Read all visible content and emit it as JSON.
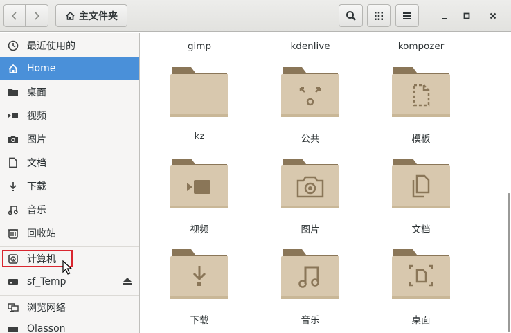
{
  "header": {
    "path_label": "主文件夹",
    "back_icon": "chevron-left-icon",
    "forward_icon": "chevron-right-icon",
    "home_icon": "home-icon",
    "search_icon": "search-icon",
    "view_icon": "grid-view-icon",
    "menu_icon": "hamburger-menu-icon"
  },
  "sidebar": {
    "items": [
      {
        "label": "最近使用的",
        "icon": "clock-icon"
      },
      {
        "label": "Home",
        "icon": "home-icon",
        "active": true
      },
      {
        "label": "桌面",
        "icon": "desktop-folder-icon"
      },
      {
        "label": "视频",
        "icon": "video-icon"
      },
      {
        "label": "图片",
        "icon": "camera-icon"
      },
      {
        "label": "文档",
        "icon": "document-icon"
      },
      {
        "label": "下载",
        "icon": "download-icon"
      },
      {
        "label": "音乐",
        "icon": "music-icon"
      },
      {
        "label": "回收站",
        "icon": "trash-icon"
      },
      {
        "label": "计算机",
        "icon": "computer-icon"
      },
      {
        "label": "sf_Temp",
        "icon": "drive-icon"
      },
      {
        "label": "浏览网络",
        "icon": "network-icon"
      },
      {
        "label": "Olasson",
        "icon": "drive-icon"
      }
    ]
  },
  "main": {
    "top_row_labels": [
      "gimp",
      "kdenlive",
      "kompozer"
    ],
    "folders": [
      {
        "label": "kz",
        "emblem": "none"
      },
      {
        "label": "公共",
        "emblem": "share"
      },
      {
        "label": "模板",
        "emblem": "template"
      },
      {
        "label": "视频",
        "emblem": "video"
      },
      {
        "label": "图片",
        "emblem": "camera"
      },
      {
        "label": "文档",
        "emblem": "documents"
      },
      {
        "label": "下载",
        "emblem": "download"
      },
      {
        "label": "音乐",
        "emblem": "music"
      },
      {
        "label": "桌面",
        "emblem": "desktop"
      }
    ]
  },
  "colors": {
    "accent": "#4a90d9",
    "folder_body": "#d8c8ae",
    "folder_tab": "#8a7658",
    "highlight": "#d9262f"
  }
}
